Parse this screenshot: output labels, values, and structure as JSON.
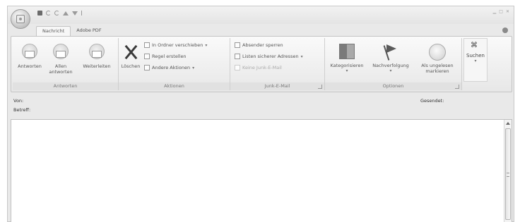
{
  "tabs": [
    {
      "label": "Nachricht",
      "active": true
    },
    {
      "label": "Adobe PDF",
      "active": false
    }
  ],
  "ribbon": {
    "antworten": {
      "label": "Antworten",
      "buttons": [
        {
          "label": "Antworten",
          "icon": "reply-icon"
        },
        {
          "label": "Allen antworten",
          "icon": "reply-all-icon"
        },
        {
          "label": "Weiterleiten",
          "icon": "forward-icon"
        }
      ]
    },
    "aktionen": {
      "label": "Aktionen",
      "delete_label": "Löschen",
      "move_label": "In Ordner verschieben",
      "rule_label": "Regel erstellen",
      "other_label": "Andere Aktionen"
    },
    "junk": {
      "label": "Junk-E-Mail",
      "block_label": "Absender sperren",
      "safe_lists_label": "Listen sicherer Adressen",
      "not_junk_label": "Keine Junk-E-Mail"
    },
    "optionen": {
      "label": "Optionen",
      "categorize_label": "Kategorisieren",
      "followup_label": "Nachverfolgung",
      "unread_label": "Als ungelesen markieren"
    },
    "find": {
      "label": "Suchen"
    }
  },
  "header": {
    "from_label": "Von:",
    "subject_label": "Betreff:",
    "sent_label": "Gesendet:"
  },
  "colors": {
    "window_bg": "#e9e9e9",
    "ribbon_bg": "#f2f2f2",
    "body_bg": "#ffffff"
  }
}
